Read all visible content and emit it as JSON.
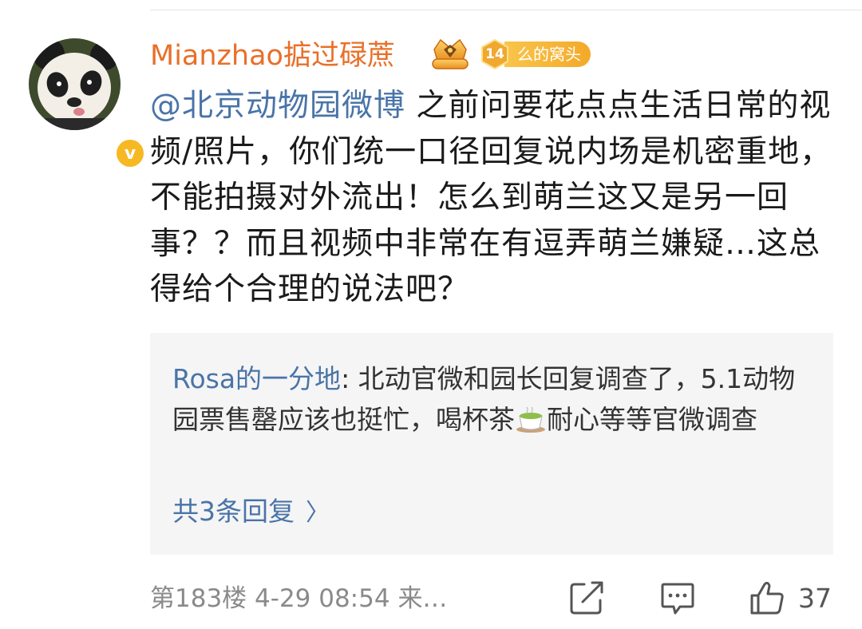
{
  "comment": {
    "username": "Mianzhao掂过碌蔗",
    "fan_badge": {
      "level": "14",
      "name": "么的窝头"
    },
    "mention": "@北京动物园微博",
    "text": " 之前问要花点点生活日常的视频/照片，你们统一口径回复说内场是机密重地，不能拍摄对外流出！怎么到萌兰这又是另一回事？？而且视频中非常在有逗弄萌兰嫌疑…这总得给个合理的说法吧？",
    "verified_icon": "v",
    "floor": "第183楼",
    "datetime": "4-29 08:54",
    "source": "来…",
    "like_count": "37"
  },
  "reply": {
    "author": "Rosa的一分地",
    "text_before_emoji": ": 北动官微和园长回复调查了，5.1动物园票售罄应该也挺忙，喝杯茶",
    "emoji": "tea-emoji",
    "text_after_emoji": "耐心等等官微调查",
    "more_label": "共3条回复",
    "more_chevron": "〉"
  },
  "icons": [
    "avatar-panda",
    "verified-badge-icon",
    "crown-badge-icon",
    "fan-level-icon",
    "tea-emoji",
    "share-icon",
    "comment-icon",
    "like-icon"
  ],
  "colors": {
    "username": "#e8702a",
    "link": "#4a74a8",
    "badge": "#f4a92a",
    "verified": "#f6b823",
    "reply_bg": "#f5f5f5",
    "meta": "#8a8a8a"
  }
}
